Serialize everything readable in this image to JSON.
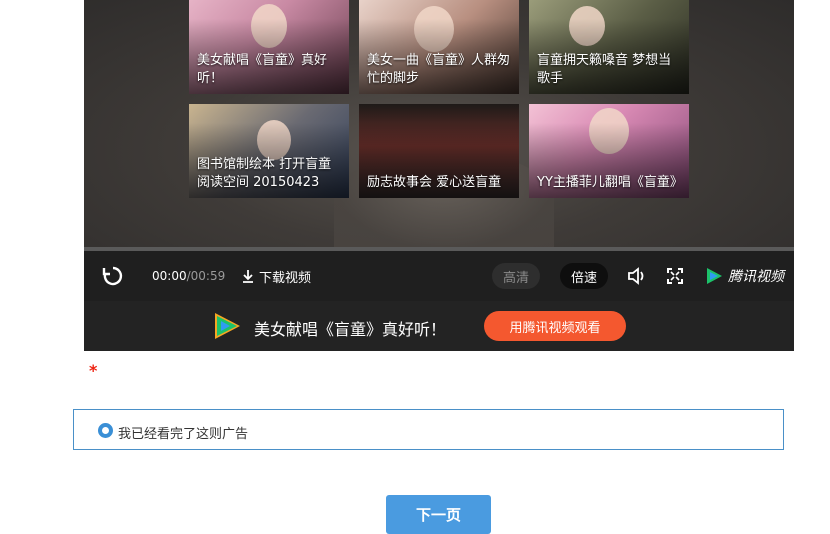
{
  "player": {
    "thumbnails": [
      {
        "caption": "美女献唱《盲童》真好听！"
      },
      {
        "caption": "美女一曲《盲童》人群匆忙的脚步"
      },
      {
        "caption": "盲童拥天籁嗓音 梦想当歌手"
      },
      {
        "caption": "图书馆制绘本 打开盲童阅读空间 20150423"
      },
      {
        "caption": "励志故事会 爱心送盲童"
      },
      {
        "caption": "YY主播菲儿翻唱《盲童》"
      }
    ],
    "controls": {
      "current_time": "00:00",
      "duration": "/00:59",
      "download_label": "下载视频",
      "quality_label": "高清",
      "speed_label": "倍速",
      "brand_label": "腾讯视频"
    },
    "banner": {
      "title": "美女献唱《盲童》真好听！",
      "watch_button": "用腾讯视频观看"
    },
    "colors": {
      "accent": "#f4582f",
      "brand_green": "#1cc26a",
      "brand_blue": "#2f9cf0"
    }
  },
  "form": {
    "required_mark": "*",
    "option_label": "我已经看完了这则广告",
    "option_checked": true
  },
  "next_button": "下一页"
}
